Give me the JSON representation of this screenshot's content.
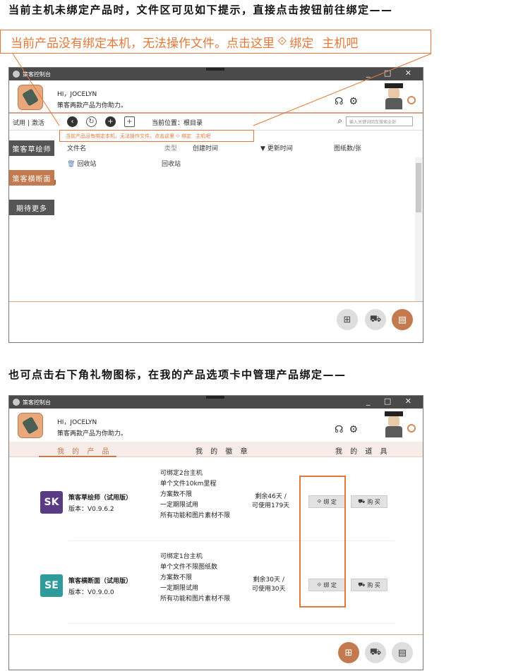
{
  "headings": {
    "first": "当前主机未绑定产品时，文件区可见如下提示，直接点击按钮前往绑定——",
    "second": "也可点击右下角礼物图标，在我的产品选项卡中管理产品绑定——"
  },
  "callout": {
    "text1": "当前产品没有绑定本机，无法操作文件。点击这里",
    "bind_word": "绑定",
    "text2": "主机吧"
  },
  "app": {
    "title": "策客控制台",
    "greeting": "HI，JOCELYN",
    "tagline": "策客两款产品为你助力。",
    "controls": "_ □ ✕"
  },
  "toolbar": {
    "trial": "试用 | 激活",
    "location": "当前位置：根目录",
    "search_placeholder": "输入关键词回车搜索全部"
  },
  "sidebar": {
    "items": [
      "策客草绘师",
      "策客横断面",
      "期待更多"
    ]
  },
  "notice": {
    "text1": "当前产品没有绑定本机，无法操作文件。点击这里",
    "bind_word": "绑定",
    "text2": "主机吧"
  },
  "filelist": {
    "columns": [
      "文件名",
      "类型",
      "创建时间",
      "更新时间",
      "图纸数/张"
    ],
    "rows": [
      {
        "name": "回收站",
        "type": "回收站"
      }
    ]
  },
  "tabs": [
    "我 的 产 品",
    "我 的 徽 章",
    "我 的 道 具"
  ],
  "products": [
    {
      "logo": "SK",
      "logo_color": "#5b3a84",
      "name": "策客草绘师（试用版）",
      "version": "版本：V0.9.6.2",
      "features": [
        "可绑定2台主机",
        "单个文件10km里程",
        "方案数不限",
        "一定期限试用",
        "所有功能和图片素材不限"
      ],
      "remain": "剩余46天 /",
      "usable": "可使用179天",
      "bind": "绑 定",
      "buy": "购 买"
    },
    {
      "logo": "SE",
      "logo_color": "#2f9b9b",
      "name": "策客横断面（试用版）",
      "version": "版本：V0.9.0.0",
      "features": [
        "可绑定1台主机",
        "单个文件不限图纸数",
        "方案数不限",
        "一定期限试用",
        "所有功能和图片素材不限"
      ],
      "remain": "剩余30天 /",
      "usable": "可使用30天",
      "bind": "绑 定",
      "buy": "购 买"
    }
  ],
  "colors": {
    "accent": "#c47a4f",
    "callout": "#e2793a"
  }
}
